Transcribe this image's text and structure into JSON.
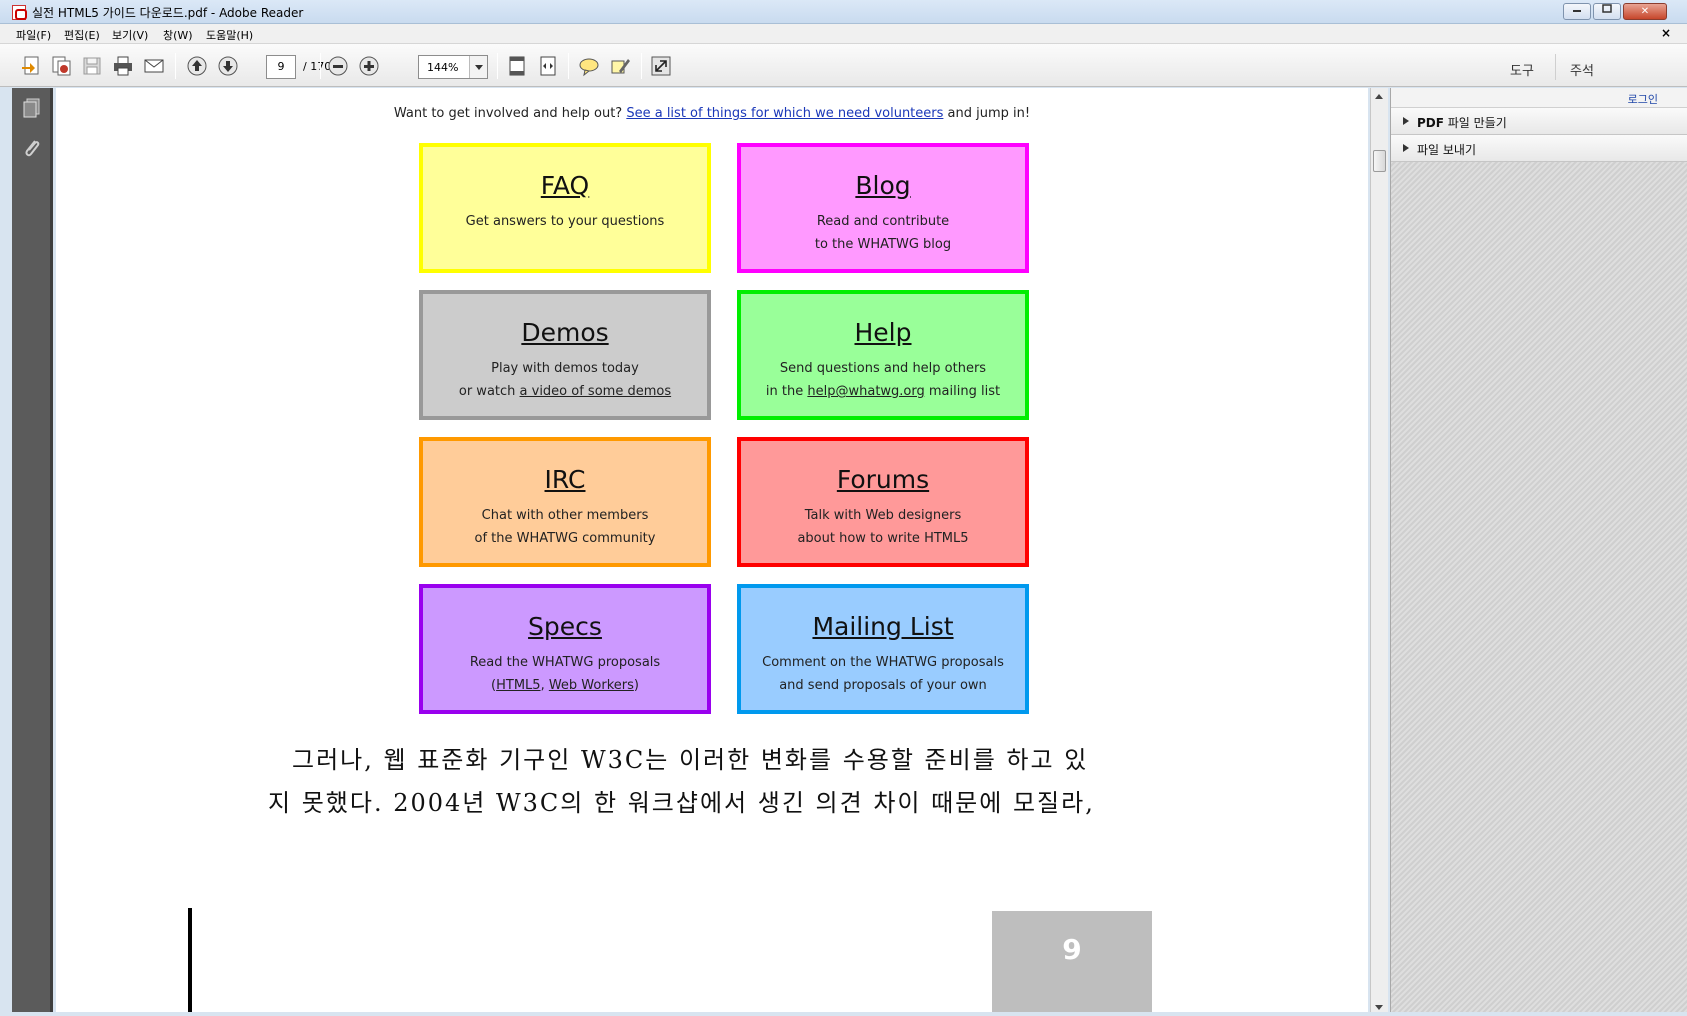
{
  "window": {
    "title": "실전 HTML5 가이드 다운로드.pdf - Adobe Reader",
    "minimize_icon": "minimize-icon",
    "maximize_icon": "restore-icon",
    "close_label": "✕"
  },
  "menubar": {
    "items": [
      "파일(F)",
      "편집(E)",
      "보기(V)",
      "창(W)",
      "도움말(H)"
    ],
    "doc_close": "×"
  },
  "toolbar": {
    "icons": [
      "create-pdf-icon",
      "combine-icon",
      "save-icon",
      "print-icon",
      "email-icon",
      "prev-page-icon",
      "next-page-icon",
      "zoom-out-icon",
      "zoom-in-icon",
      "fit-page-icon",
      "fit-width-icon",
      "comment-icon",
      "highlight-icon",
      "full-screen-icon"
    ],
    "page_number": "9",
    "page_total": "/ 170",
    "zoom": "144%",
    "tools_label": "도구",
    "comment_label": "주석"
  },
  "document": {
    "intro_prefix": "Want to get involved and help out?",
    "intro_link": "See a list of things for which we need volunteers",
    "intro_suffix": "and jump in!",
    "cards": [
      {
        "title": "FAQ",
        "line1": "Get answers to your questions",
        "line2": "",
        "color": "#ffff99",
        "border": "#ffff00"
      },
      {
        "title": "Blog",
        "line1": "Read and contribute",
        "line2": "to the WHATWG blog",
        "color": "#ff99ff",
        "border": "#ff00ff"
      },
      {
        "title": "Demos",
        "line1": "Play with demos today",
        "line2_prefix": "or watch ",
        "line2_link": "a video of some demos",
        "color": "#cccccc",
        "border": "#999999"
      },
      {
        "title": "Help",
        "line1": "Send questions and help others",
        "line2_prefix": "in the ",
        "line2_link": "help@whatwg.org",
        "line2_suffix": " mailing list",
        "color": "#99ff99",
        "border": "#00ee00"
      },
      {
        "title": "IRC",
        "line1": "Chat with other members",
        "line2": "of the WHATWG community",
        "color": "#ffcc99",
        "border": "#ff9900"
      },
      {
        "title": "Forums",
        "line1": "Talk with Web designers",
        "line2": "about how to write HTML5",
        "color": "#ff9999",
        "border": "#ff0000"
      },
      {
        "title": "Specs",
        "line1": "Read the WHATWG proposals",
        "line2_open": "(",
        "line2_link1": "HTML5",
        "line2_sep": ", ",
        "line2_link2": "Web Workers",
        "line2_close": ")",
        "color": "#cc99ff",
        "border": "#9900ee"
      },
      {
        "title": "Mailing List",
        "line1": "Comment on the WHATWG proposals",
        "line2": "and send proposals of your own",
        "color": "#99ccff",
        "border": "#0099ee"
      }
    ],
    "korean_line1": "그러나, 웹 표준화 기구인 W3C는 이러한 변화를 수용할 준비를 하고 있",
    "korean_line2": "지 못했다. 2004년 W3C의 한 워크샵에서 생긴 의견 차이 때문에 모질라,",
    "page_badge": "9"
  },
  "leftstrip": {
    "icons": [
      "page-thumbnails-icon",
      "attachments-icon"
    ]
  },
  "rightpanel": {
    "login": "로그인",
    "items": [
      {
        "bold": "PDF",
        "label": " 파일 만들기"
      },
      {
        "bold": "",
        "label": "파일 보내기"
      }
    ]
  }
}
